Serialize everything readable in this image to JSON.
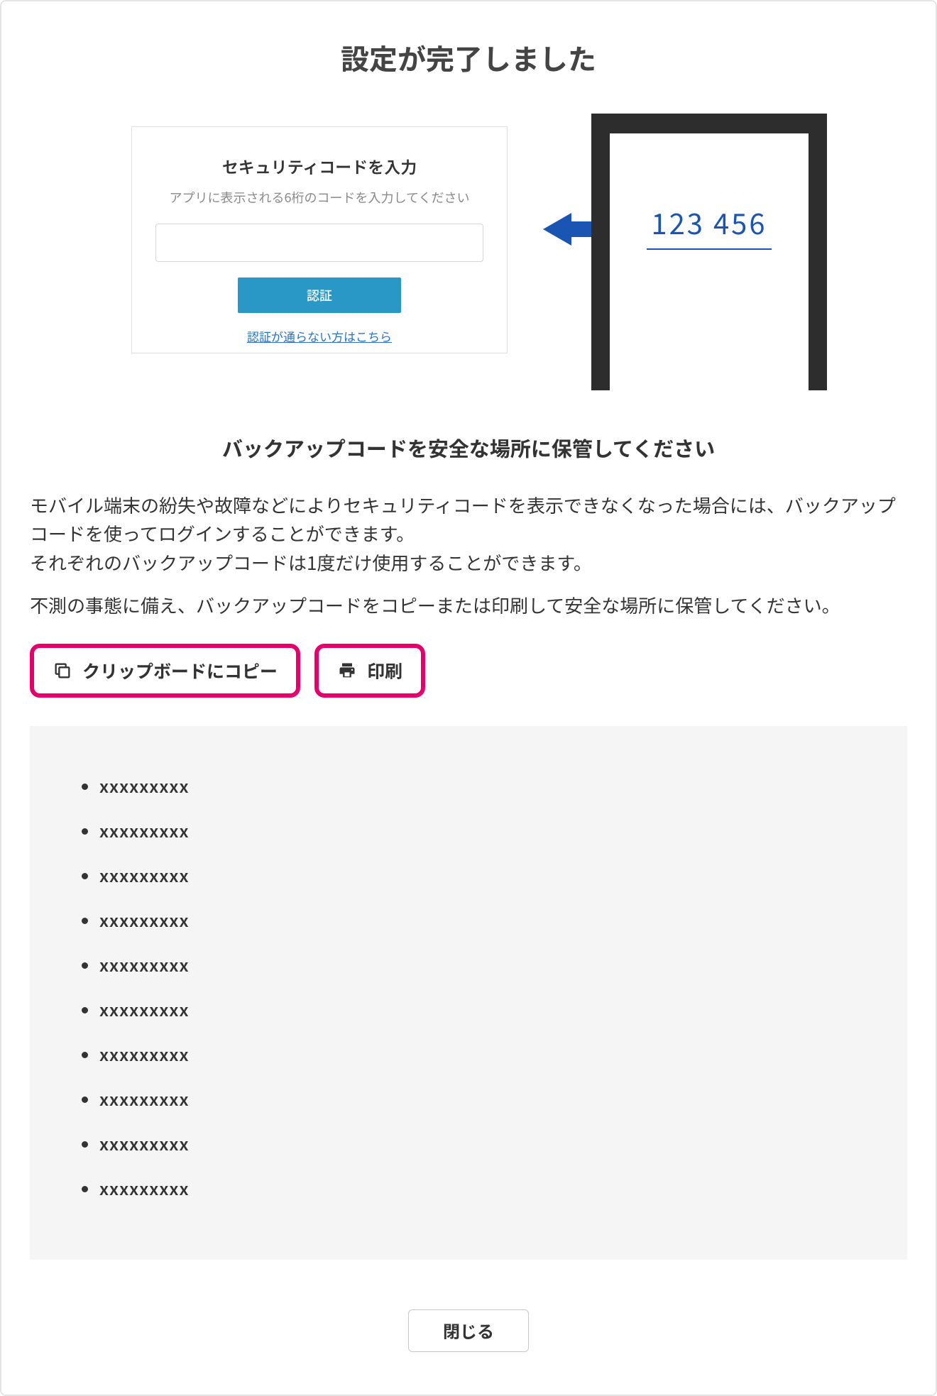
{
  "title": "設定が完了しました",
  "illustration": {
    "dialog": {
      "title": "セキュリティコードを入力",
      "subtitle": "アプリに表示される6桁のコードを入力してください",
      "verify_label": "認証",
      "help_link": "認証が通らない方はこちら"
    },
    "phone_code": "123 456"
  },
  "subheading": "バックアップコードを安全な場所に保管してください",
  "body1": "モバイル端末の紛失や故障などによりセキュリティコードを表示できなくなった場合には、バックアップコードを使ってログインすることができます。\nそれぞれのバックアップコードは1度だけ使用することができます。",
  "body2": "不測の事態に備え、バックアップコードをコピーまたは印刷して安全な場所に保管してください。",
  "actions": {
    "copy_label": "クリップボードにコピー",
    "print_label": "印刷"
  },
  "backup_codes": [
    "xxxxxxxxx",
    "xxxxxxxxx",
    "xxxxxxxxx",
    "xxxxxxxxx",
    "xxxxxxxxx",
    "xxxxxxxxx",
    "xxxxxxxxx",
    "xxxxxxxxx",
    "xxxxxxxxx",
    "xxxxxxxxx"
  ],
  "close_label": "閉じる"
}
